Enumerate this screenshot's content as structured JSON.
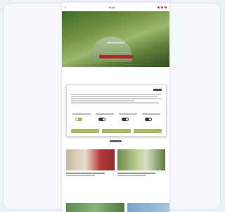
{
  "topbar": {
    "logo": "Visit",
    "menu_label": "≡"
  },
  "hero": {
    "title": "Découvrez",
    "cta_label": ""
  },
  "section_title": "",
  "modal": {
    "title": "",
    "close_label": ""
  },
  "cookie_toggles": [
    {
      "label": "",
      "state": "on"
    },
    {
      "label": "",
      "state": "off"
    },
    {
      "label": "",
      "state": "off"
    },
    {
      "label": "",
      "state": "off"
    }
  ],
  "cards": [
    {
      "caption": ""
    },
    {
      "caption": ""
    }
  ],
  "section_title_2": ""
}
